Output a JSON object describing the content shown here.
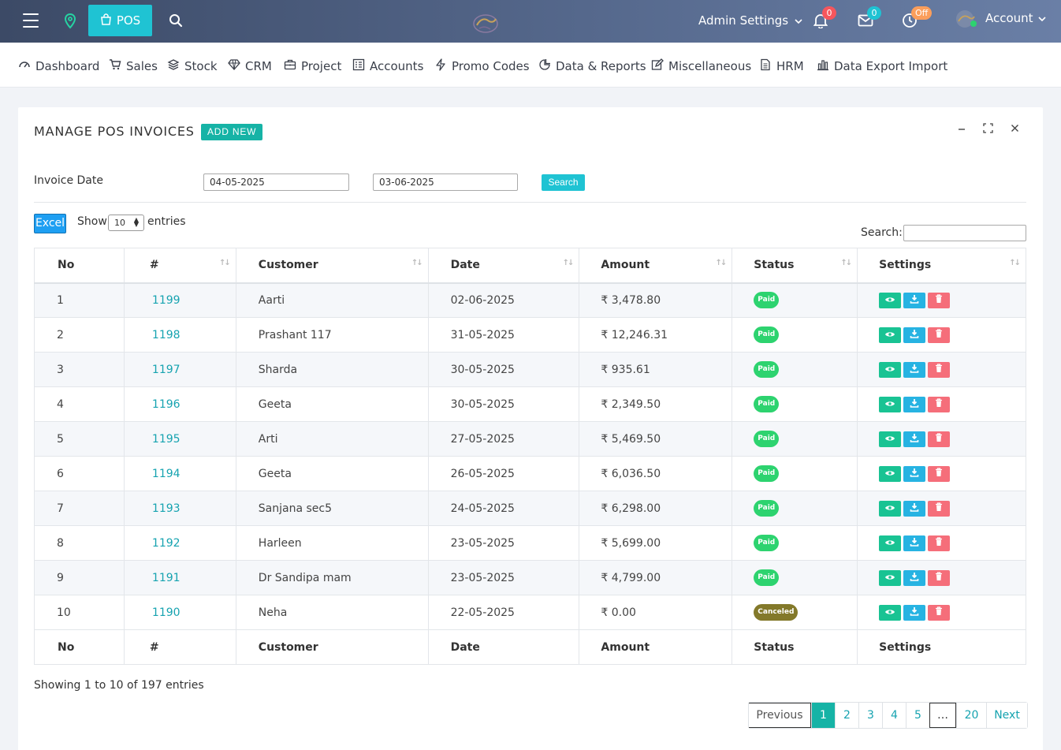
{
  "topbar": {
    "pos_label": "POS",
    "admin_label": "Admin Settings",
    "notifications_count": "0",
    "messages_count": "0",
    "timer_status": "Off",
    "account_label": "Account"
  },
  "nav": [
    {
      "label": "Dashboard",
      "icon": "dashboard-icon"
    },
    {
      "label": "Sales",
      "icon": "cart-icon"
    },
    {
      "label": "Stock",
      "icon": "layers-icon"
    },
    {
      "label": "CRM",
      "icon": "diamond-icon"
    },
    {
      "label": "Project",
      "icon": "briefcase-icon"
    },
    {
      "label": "Accounts",
      "icon": "ledger-icon"
    },
    {
      "label": "Promo Codes",
      "icon": "bolt-icon"
    },
    {
      "label": "Data & Reports",
      "icon": "pie-icon"
    },
    {
      "label": "Miscellaneous",
      "icon": "edit-icon"
    },
    {
      "label": "HRM",
      "icon": "document-icon"
    },
    {
      "label": "Data Export Import",
      "icon": "bar-chart-icon"
    }
  ],
  "card": {
    "title": "MANAGE POS INVOICES",
    "add_new": "ADD NEW"
  },
  "filters": {
    "invoice_date_label": "Invoice Date",
    "from_date": "04-05-2025",
    "to_date": "03-06-2025",
    "search_button": "Search"
  },
  "table_controls": {
    "excel": "Excel",
    "show": "Show",
    "entries_value": "10",
    "entries": "entries",
    "search_label": "Search:"
  },
  "table": {
    "headers": [
      "No",
      "#",
      "Customer",
      "Date",
      "Amount",
      "Status",
      "Settings"
    ],
    "rows": [
      {
        "no": "1",
        "id": "1199",
        "customer": "Aarti",
        "date": "02-06-2025",
        "amount": "₹ 3,478.80",
        "status": "Paid"
      },
      {
        "no": "2",
        "id": "1198",
        "customer": "Prashant 117",
        "date": "31-05-2025",
        "amount": "₹ 12,246.31",
        "status": "Paid"
      },
      {
        "no": "3",
        "id": "1197",
        "customer": "Sharda",
        "date": "30-05-2025",
        "amount": "₹ 935.61",
        "status": "Paid"
      },
      {
        "no": "4",
        "id": "1196",
        "customer": "Geeta",
        "date": "30-05-2025",
        "amount": "₹ 2,349.50",
        "status": "Paid"
      },
      {
        "no": "5",
        "id": "1195",
        "customer": "Arti",
        "date": "27-05-2025",
        "amount": "₹ 5,469.50",
        "status": "Paid"
      },
      {
        "no": "6",
        "id": "1194",
        "customer": "Geeta",
        "date": "26-05-2025",
        "amount": "₹ 6,036.50",
        "status": "Paid"
      },
      {
        "no": "7",
        "id": "1193",
        "customer": "Sanjana sec5",
        "date": "24-05-2025",
        "amount": "₹ 6,298.00",
        "status": "Paid"
      },
      {
        "no": "8",
        "id": "1192",
        "customer": "Harleen",
        "date": "23-05-2025",
        "amount": "₹ 5,699.00",
        "status": "Paid"
      },
      {
        "no": "9",
        "id": "1191",
        "customer": "Dr Sandipa mam",
        "date": "23-05-2025",
        "amount": "₹ 4,799.00",
        "status": "Paid"
      },
      {
        "no": "10",
        "id": "1190",
        "customer": "Neha",
        "date": "22-05-2025",
        "amount": "₹ 0.00",
        "status": "Canceled"
      }
    ]
  },
  "footer": {
    "info": "Showing 1 to 10 of 197 entries",
    "pagination": [
      "Previous",
      "1",
      "2",
      "3",
      "4",
      "5",
      "…",
      "20",
      "Next"
    ],
    "active_page": "1"
  },
  "colors": {
    "topbar_start": "#3c4a66",
    "accent_cyan": "#1fc3d3",
    "teal": "#16b3a6",
    "paid": "#2dd36f",
    "canceled": "#83792a",
    "view": "#19c393",
    "download": "#27b3e2",
    "delete": "#f56e7a"
  }
}
